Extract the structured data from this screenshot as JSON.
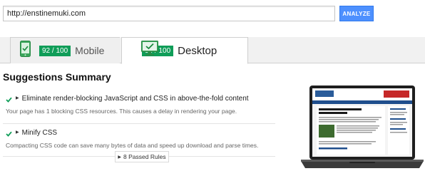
{
  "url_bar": {
    "value": "http://enstinemuki.com",
    "button_label": "ANALYZE"
  },
  "tabs": [
    {
      "label": "Mobile",
      "score": "92 / 100",
      "icon": "phone-icon",
      "active": false
    },
    {
      "label": "Desktop",
      "score": "98 / 100",
      "icon": "monitor-icon",
      "active": true
    }
  ],
  "summary": {
    "title": "Suggestions Summary",
    "rules": [
      {
        "title": "Eliminate render-blocking JavaScript and CSS in above-the-fold content",
        "description": "Your page has 1 blocking CSS resources. This causes a delay in rendering your page."
      },
      {
        "title": "Minify CSS",
        "description": "Compacting CSS code can save many bytes of data and speed up download and parse times."
      }
    ],
    "passed_rules_label": "8 Passed Rules"
  },
  "colors": {
    "accent_blue": "#4d90fe",
    "score_green": "#0f9d58",
    "check_green": "#0f9d58"
  }
}
